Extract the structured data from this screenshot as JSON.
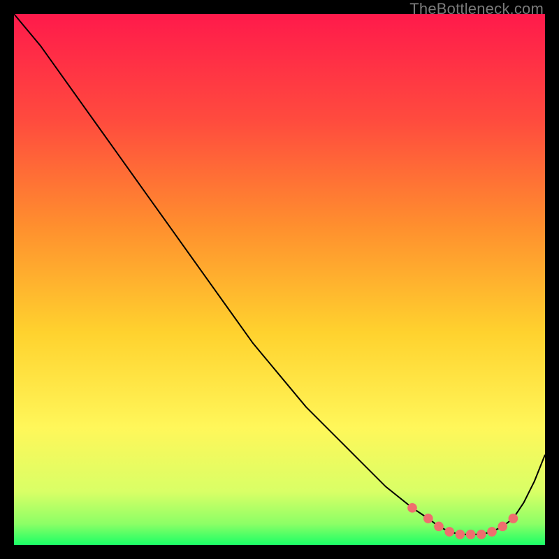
{
  "watermark": "TheBottleneck.com",
  "colors": {
    "gradient_stops": [
      {
        "offset": 0.0,
        "color": "#ff1a4b"
      },
      {
        "offset": 0.2,
        "color": "#ff4b3e"
      },
      {
        "offset": 0.4,
        "color": "#ff8f2e"
      },
      {
        "offset": 0.6,
        "color": "#ffd22e"
      },
      {
        "offset": 0.78,
        "color": "#fff75a"
      },
      {
        "offset": 0.9,
        "color": "#d9ff66"
      },
      {
        "offset": 0.96,
        "color": "#8cff66"
      },
      {
        "offset": 1.0,
        "color": "#1aff66"
      }
    ],
    "line": "#000000",
    "marker": "#ef6e6e"
  },
  "chart_data": {
    "type": "line",
    "title": "",
    "xlabel": "",
    "ylabel": "",
    "xlim": [
      0,
      100
    ],
    "ylim": [
      0,
      100
    ],
    "grid": false,
    "series": [
      {
        "name": "curve",
        "x": [
          0,
          5,
          10,
          15,
          20,
          25,
          30,
          35,
          40,
          45,
          50,
          55,
          60,
          65,
          70,
          75,
          78,
          80,
          82,
          84,
          86,
          88,
          90,
          92,
          94,
          96,
          98,
          100
        ],
        "y": [
          100,
          94,
          87,
          80,
          73,
          66,
          59,
          52,
          45,
          38,
          32,
          26,
          21,
          16,
          11,
          7,
          5,
          3.5,
          2.5,
          2,
          2,
          2,
          2.5,
          3.5,
          5,
          8,
          12,
          17
        ]
      }
    ],
    "markers": {
      "name": "highlight",
      "x": [
        75,
        78,
        80,
        82,
        84,
        86,
        88,
        90,
        92,
        94
      ],
      "y": [
        7,
        5,
        3.5,
        2.5,
        2,
        2,
        2,
        2.5,
        3.5,
        5
      ]
    }
  }
}
